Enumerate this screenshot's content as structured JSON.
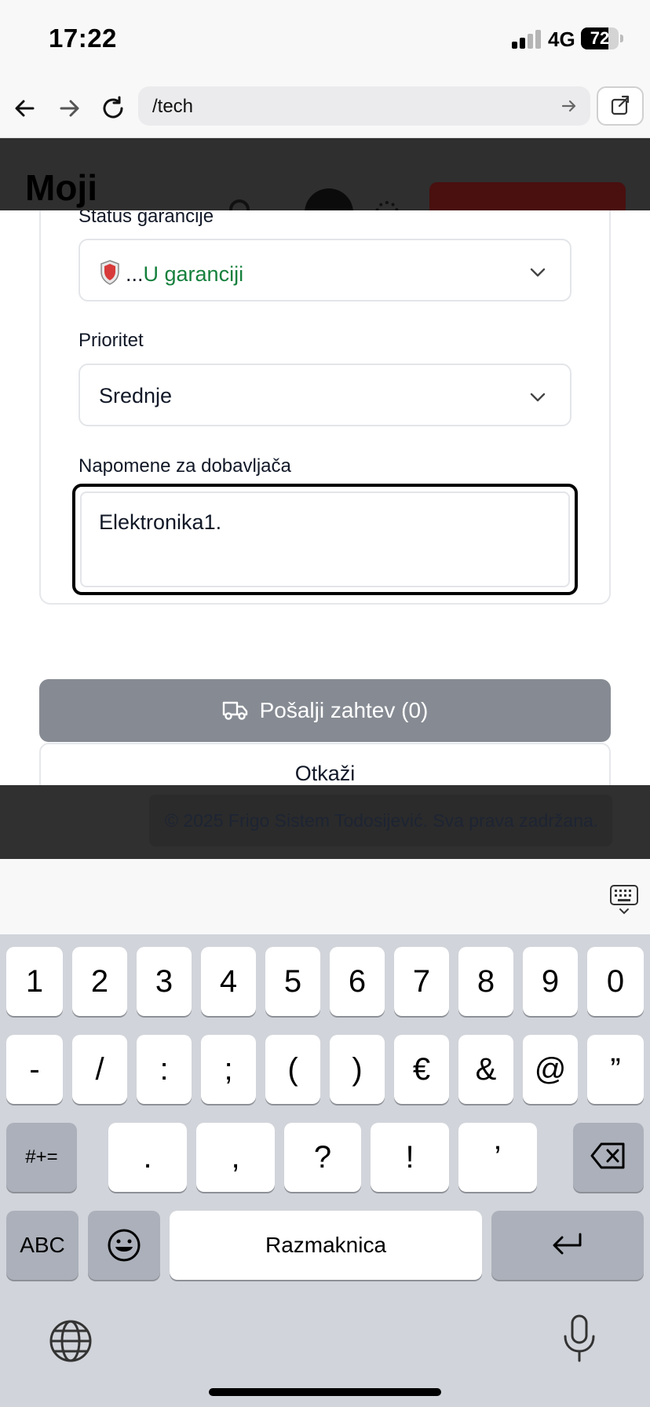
{
  "status_bar": {
    "time": "17:22",
    "network": "4G",
    "battery_percent": 72,
    "battery_label": "72"
  },
  "browser": {
    "url": "/tech"
  },
  "page_header": {
    "title": "Moji"
  },
  "form": {
    "warranty_label": "Status garancije",
    "warranty_value": "U garanciji",
    "warranty_prefix": "...",
    "priority_label": "Prioritet",
    "priority_value": "Srednje",
    "notes_label": "Napomene za dobavljača",
    "notes_value": "Elektronika1."
  },
  "actions": {
    "send_label": "Pošalji zahtev (0)",
    "cancel_label": "Otkaži"
  },
  "footer": {
    "copyright": "© 2025 Frigo Sistem Todosijević. Sva prava zadržana."
  },
  "keyboard": {
    "row1": [
      "1",
      "2",
      "3",
      "4",
      "5",
      "6",
      "7",
      "8",
      "9",
      "0"
    ],
    "row2": [
      "-",
      "/",
      ":",
      ";",
      "(",
      ")",
      "€",
      "&",
      "@",
      "”"
    ],
    "row3_symbols": "#+=",
    "row3": [
      ".",
      ",",
      "?",
      "!",
      "’"
    ],
    "abc": "ABC",
    "space": "Razmaknica"
  },
  "colors": {
    "accent_green": "#15803d",
    "send_button": "#868b93"
  }
}
